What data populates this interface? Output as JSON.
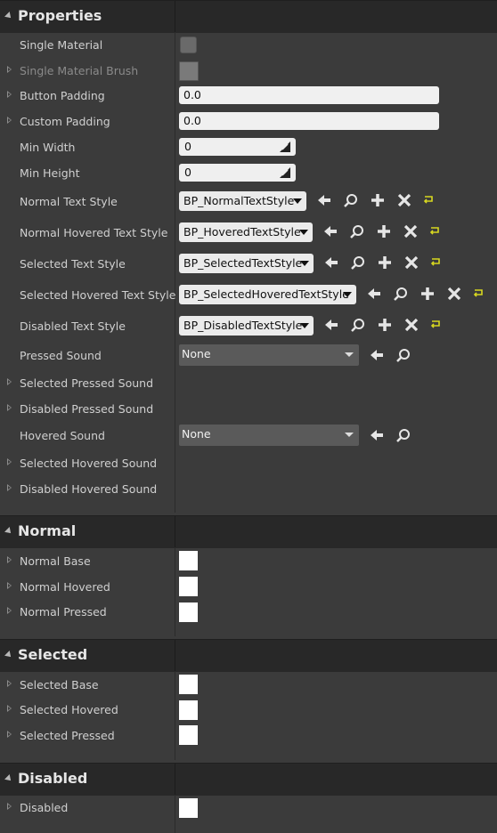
{
  "sections": {
    "properties": {
      "title": "Properties"
    },
    "normal": {
      "title": "Normal"
    },
    "selected": {
      "title": "Selected"
    },
    "disabled": {
      "title": "Disabled"
    }
  },
  "properties": {
    "single_material": {
      "label": "Single Material",
      "checked": false
    },
    "single_material_brush": {
      "label": "Single Material Brush"
    },
    "button_padding": {
      "label": "Button Padding",
      "value": "0.0"
    },
    "custom_padding": {
      "label": "Custom Padding",
      "value": "0.0"
    },
    "min_width": {
      "label": "Min Width",
      "value": "0"
    },
    "min_height": {
      "label": "Min Height",
      "value": "0"
    },
    "normal_text_style": {
      "label": "Normal Text Style",
      "value": "BP_NormalTextStyle"
    },
    "normal_hovered_text_style": {
      "label": "Normal Hovered Text Style",
      "value": "BP_HoveredTextStyle"
    },
    "selected_text_style": {
      "label": "Selected Text Style",
      "value": "BP_SelectedTextStyle"
    },
    "selected_hovered_text_style": {
      "label": "Selected Hovered Text Style",
      "value": "BP_SelectedHoveredTextStyle"
    },
    "disabled_text_style": {
      "label": "Disabled Text Style",
      "value": "BP_DisabledTextStyle"
    },
    "pressed_sound": {
      "label": "Pressed Sound",
      "value": "None"
    },
    "selected_pressed_sound": {
      "label": "Selected Pressed Sound"
    },
    "disabled_pressed_sound": {
      "label": "Disabled Pressed Sound"
    },
    "hovered_sound": {
      "label": "Hovered Sound",
      "value": "None"
    },
    "selected_hovered_sound": {
      "label": "Selected Hovered Sound"
    },
    "disabled_hovered_sound": {
      "label": "Disabled Hovered Sound"
    }
  },
  "normal": {
    "base": {
      "label": "Normal Base",
      "color": "#ffffff"
    },
    "hovered": {
      "label": "Normal Hovered",
      "color": "#ffffff"
    },
    "pressed": {
      "label": "Normal Pressed",
      "color": "#ffffff"
    }
  },
  "selected": {
    "base": {
      "label": "Selected Base",
      "color": "#ffffff"
    },
    "hovered": {
      "label": "Selected Hovered",
      "color": "#ffffff"
    },
    "pressed": {
      "label": "Selected Pressed",
      "color": "#ffffff"
    }
  },
  "disabled": {
    "disabled": {
      "label": "Disabled",
      "color": "#ffffff"
    }
  },
  "icons": [
    "use-selected-arrow-icon",
    "browse-search-icon",
    "add-plus-icon",
    "clear-x-icon",
    "reset-to-default-icon",
    "drag-resize-icon"
  ],
  "colors": {
    "panel_bg": "#3b3b3b",
    "header_bg": "#282828",
    "reset_arrow": "#d8d820"
  }
}
